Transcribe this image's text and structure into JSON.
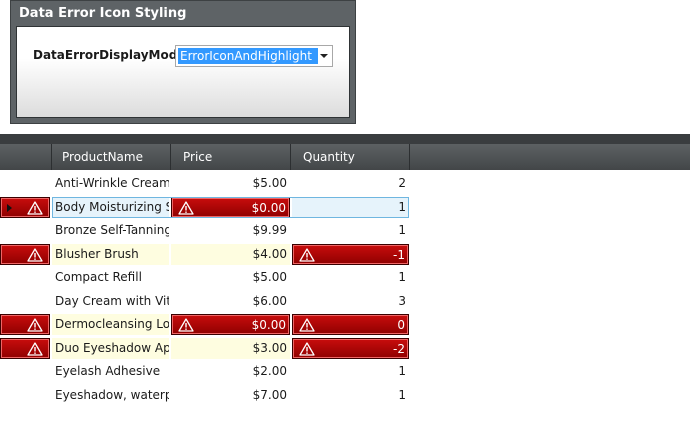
{
  "panel": {
    "title": "Data Error Icon Styling",
    "mode_label": "DataErrorDisplayMode:",
    "mode_value": "ErrorIconAndHighlight"
  },
  "grid": {
    "columns": [
      "ProductName",
      "Price",
      "Quantity"
    ],
    "rows": [
      {
        "name": "Anti-Wrinkle Cream",
        "price": "$5.00",
        "qty": "2",
        "row_error": false,
        "price_error": false,
        "qty_error": false,
        "selected": false,
        "highlight": false
      },
      {
        "name": "Body Moisturizing Sp",
        "price": "$0.00",
        "qty": "1",
        "row_error": true,
        "price_error": true,
        "qty_error": false,
        "selected": true,
        "highlight": false
      },
      {
        "name": "Bronze Self-Tanning I",
        "price": "$9.99",
        "qty": "1",
        "row_error": false,
        "price_error": false,
        "qty_error": false,
        "selected": false,
        "highlight": false
      },
      {
        "name": "Blusher Brush",
        "price": "$4.00",
        "qty": "-1",
        "row_error": true,
        "price_error": false,
        "qty_error": true,
        "selected": false,
        "highlight": true
      },
      {
        "name": "Compact Refill",
        "price": "$5.00",
        "qty": "1",
        "row_error": false,
        "price_error": false,
        "qty_error": false,
        "selected": false,
        "highlight": false
      },
      {
        "name": "Day Cream with Vitar",
        "price": "$6.00",
        "qty": "3",
        "row_error": false,
        "price_error": false,
        "qty_error": false,
        "selected": false,
        "highlight": false
      },
      {
        "name": "Dermocleansing Lotic",
        "price": "$0.00",
        "qty": "0",
        "row_error": true,
        "price_error": true,
        "qty_error": true,
        "selected": false,
        "highlight": true
      },
      {
        "name": "Duo Eyeshadow Appl",
        "price": "$3.00",
        "qty": "-2",
        "row_error": true,
        "price_error": false,
        "qty_error": true,
        "selected": false,
        "highlight": true
      },
      {
        "name": "Eyelash Adhesive",
        "price": "$2.00",
        "qty": "1",
        "row_error": false,
        "price_error": false,
        "qty_error": false,
        "selected": false,
        "highlight": false
      },
      {
        "name": "Eyeshadow, waterpro",
        "price": "$7.00",
        "qty": "1",
        "row_error": false,
        "price_error": false,
        "qty_error": false,
        "selected": false,
        "highlight": false
      }
    ]
  },
  "colors": {
    "error_red": "#b00000",
    "highlight_yellow": "#fefde0",
    "selection_blue": "#3399ff"
  },
  "icons": {
    "error": "warning-triangle-icon",
    "current_row": "row-indicator-arrow-icon",
    "dropdown": "chevron-down-icon"
  }
}
